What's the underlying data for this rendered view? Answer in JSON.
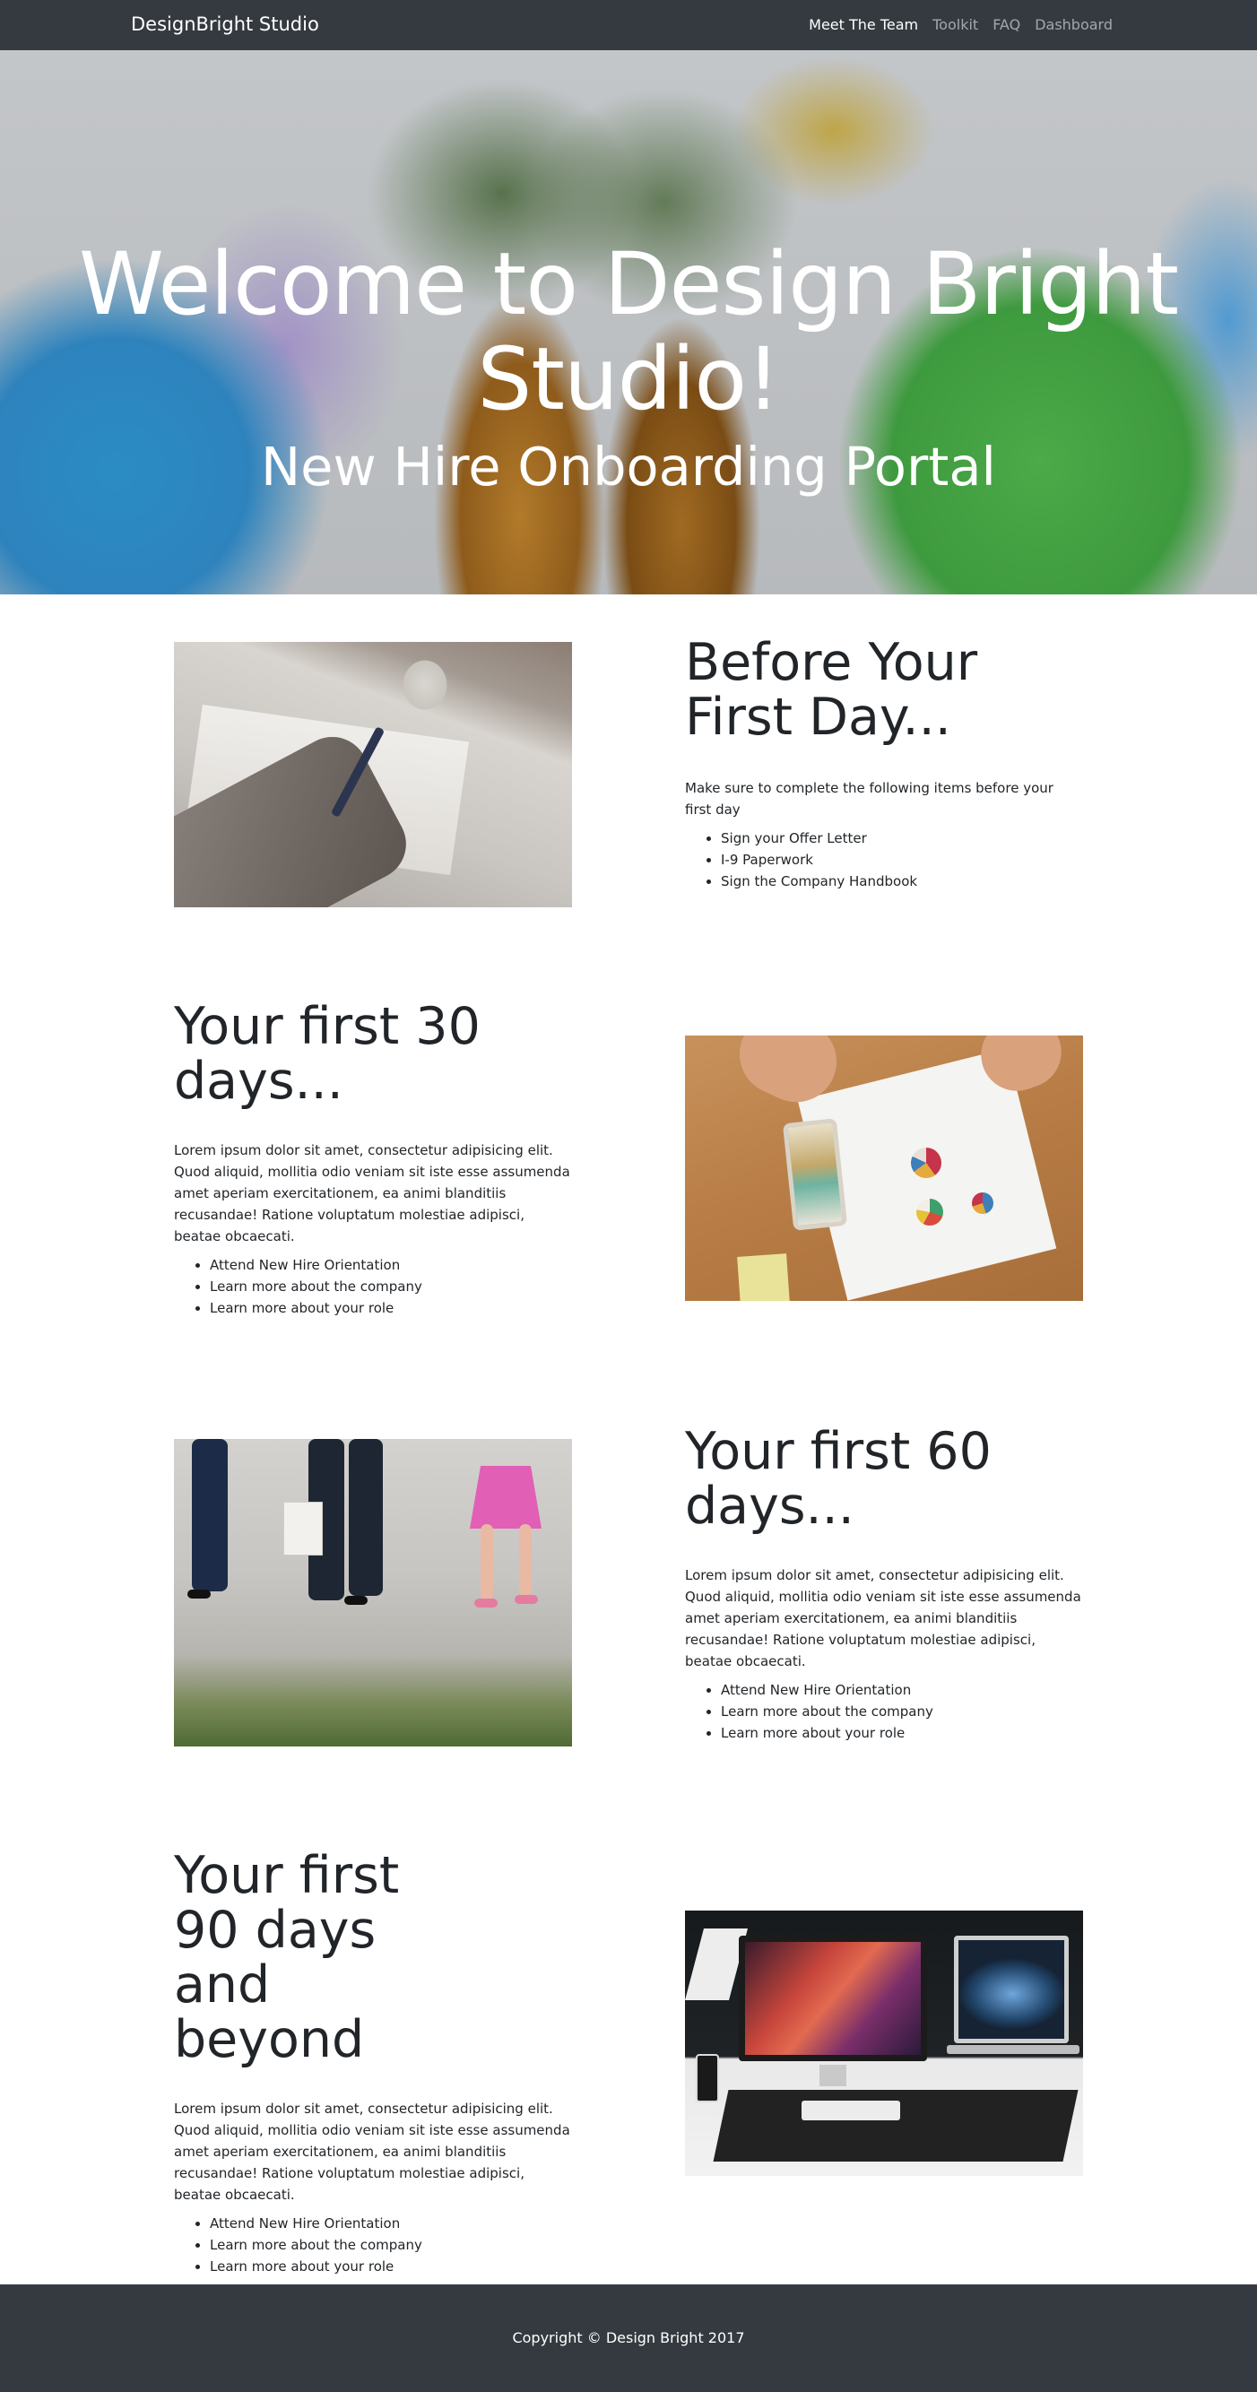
{
  "navbar": {
    "brand": "DesignBright Studio",
    "links": [
      {
        "label": "Meet The Team",
        "active": true
      },
      {
        "label": "Toolkit",
        "active": false
      },
      {
        "label": "FAQ",
        "active": false
      },
      {
        "label": "Dashboard",
        "active": false
      }
    ]
  },
  "hero": {
    "title": "Welcome to Design Bright Studio!",
    "subtitle": "New Hire Onboarding Portal"
  },
  "sections": [
    {
      "heading": "Before Your First Day...",
      "text": "Make sure to complete the following items before your first day",
      "items": [
        "Sign your Offer Letter",
        "I-9 Paperwork",
        "Sign the Company Handbook"
      ]
    },
    {
      "heading": "Your first 30 days...",
      "text": "Lorem ipsum dolor sit amet, consectetur adipisicing elit. Quod aliquid, mollitia odio veniam sit iste esse assumenda amet aperiam exercitationem, ea animi blanditiis recusandae! Ratione voluptatum molestiae adipisci, beatae obcaecati.",
      "items": [
        "Attend New Hire Orientation",
        "Learn more about the company",
        "Learn more about your role"
      ]
    },
    {
      "heading": "Your first 60 days...",
      "text": "Lorem ipsum dolor sit amet, consectetur adipisicing elit. Quod aliquid, mollitia odio veniam sit iste esse assumenda amet aperiam exercitationem, ea animi blanditiis recusandae! Ratione voluptatum molestiae adipisci, beatae obcaecati.",
      "items": [
        "Attend New Hire Orientation",
        "Learn more about the company",
        "Learn more about your role"
      ]
    },
    {
      "heading": "Your first 90 days and beyond",
      "text": "Lorem ipsum dolor sit amet, consectetur adipisicing elit. Quod aliquid, mollitia odio veniam sit iste esse assumenda amet aperiam exercitationem, ea animi blanditiis recusandae! Ratione voluptatum molestiae adipisci, beatae obcaecati.",
      "items": [
        "Attend New Hire Orientation",
        "Learn more about the company",
        "Learn more about your role"
      ]
    }
  ],
  "footer": {
    "copyright": "Copyright © Design Bright 2017"
  },
  "colors": {
    "navbar_bg": "#343a40",
    "footer_bg": "#343a40",
    "text": "#212529",
    "nav_inactive": "rgba(255,255,255,0.55)"
  }
}
